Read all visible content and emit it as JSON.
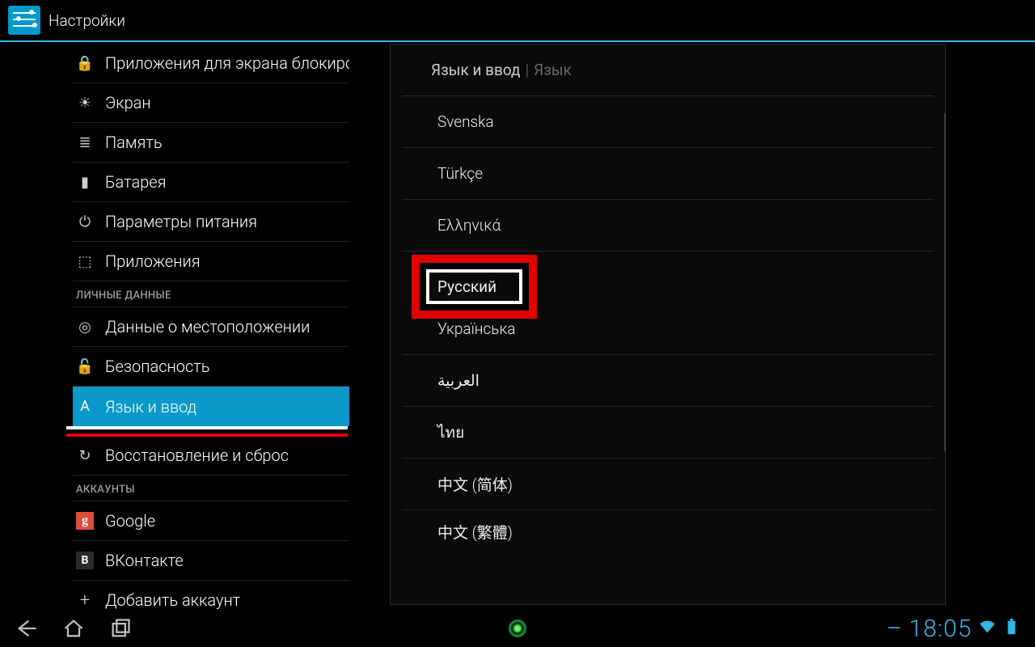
{
  "appbar": {
    "title": "Настройки"
  },
  "left": {
    "items": [
      {
        "label": "Приложения для экрана блокировки",
        "icon": "lock-icon"
      },
      {
        "label": "Экран",
        "icon": "display-icon"
      },
      {
        "label": "Память",
        "icon": "storage-icon"
      },
      {
        "label": "Батарея",
        "icon": "battery-icon"
      },
      {
        "label": "Параметры питания",
        "icon": "power-icon"
      },
      {
        "label": "Приложения",
        "icon": "apps-icon"
      }
    ],
    "section_personal": "ЛИЧНЫЕ ДАННЫЕ",
    "personal": [
      {
        "label": "Данные о местоположении",
        "icon": "location-icon"
      },
      {
        "label": "Безопасность",
        "icon": "security-icon"
      },
      {
        "label": "Язык и ввод",
        "icon": "language-icon",
        "selected": true
      },
      {
        "label": "Восстановление и сброс",
        "icon": "backup-icon"
      }
    ],
    "section_accounts": "АККАУНТЫ",
    "accounts": [
      {
        "label": "Google",
        "icon": "google-icon"
      },
      {
        "label": "ВКонтакте",
        "icon": "vk-icon"
      },
      {
        "label": "Добавить аккаунт",
        "icon": "plus-icon"
      }
    ]
  },
  "right": {
    "breadcrumb_main": "Язык и ввод",
    "breadcrumb_sub": "Язык",
    "languages": [
      "Svenska",
      "Türkçe",
      "Ελληνικά",
      "Русский",
      "Українська",
      "العربية",
      "ไทย",
      "中文 (简体)",
      "中文 (繁體)"
    ],
    "highlighted_index": 3
  },
  "navbar": {
    "time": "18:05"
  }
}
